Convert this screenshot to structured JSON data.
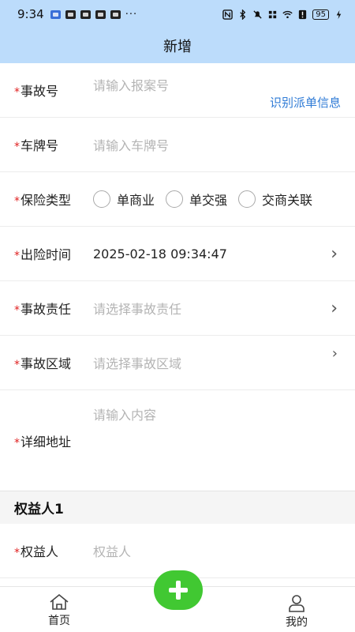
{
  "status_bar": {
    "time": "9:34",
    "more": "···",
    "battery": "95",
    "notification_icons": [
      "app-notification-icon",
      "app-notification-icon",
      "app-notification-icon",
      "app-notification-icon",
      "app-notification-icon"
    ],
    "right_icons": [
      "nfc-icon",
      "bluetooth-icon",
      "mute-icon",
      "network-speed-icon",
      "wifi-icon",
      "alert-icon",
      "battery-icon",
      "charging-icon"
    ]
  },
  "header": {
    "title": "新增"
  },
  "form": {
    "required_mark": "*",
    "case_no": {
      "label": "事故号",
      "placeholder": "请输入报案号",
      "link": "识别派单信息"
    },
    "plate": {
      "label": "车牌号",
      "placeholder": "请输入车牌号"
    },
    "insurance_type": {
      "label": "保险类型",
      "options": [
        "单商业",
        "单交强",
        "交商关联"
      ]
    },
    "time": {
      "label": "出险时间",
      "value": "2025-02-18 09:34:47"
    },
    "liability": {
      "label": "事故责任",
      "placeholder": "请选择事故责任"
    },
    "area": {
      "label": "事故区域",
      "placeholder": "请选择事故区域"
    },
    "address": {
      "label": "详细地址",
      "placeholder": "请输入内容"
    }
  },
  "beneficiary": {
    "section_title": "权益人1",
    "label": "权益人",
    "placeholder": "权益人"
  },
  "tabbar": {
    "home": "首页",
    "mine": "我的"
  },
  "colors": {
    "header_bg": "#bcdcfb",
    "link": "#2f7bd6",
    "fab": "#41c832",
    "required": "#e02020"
  }
}
